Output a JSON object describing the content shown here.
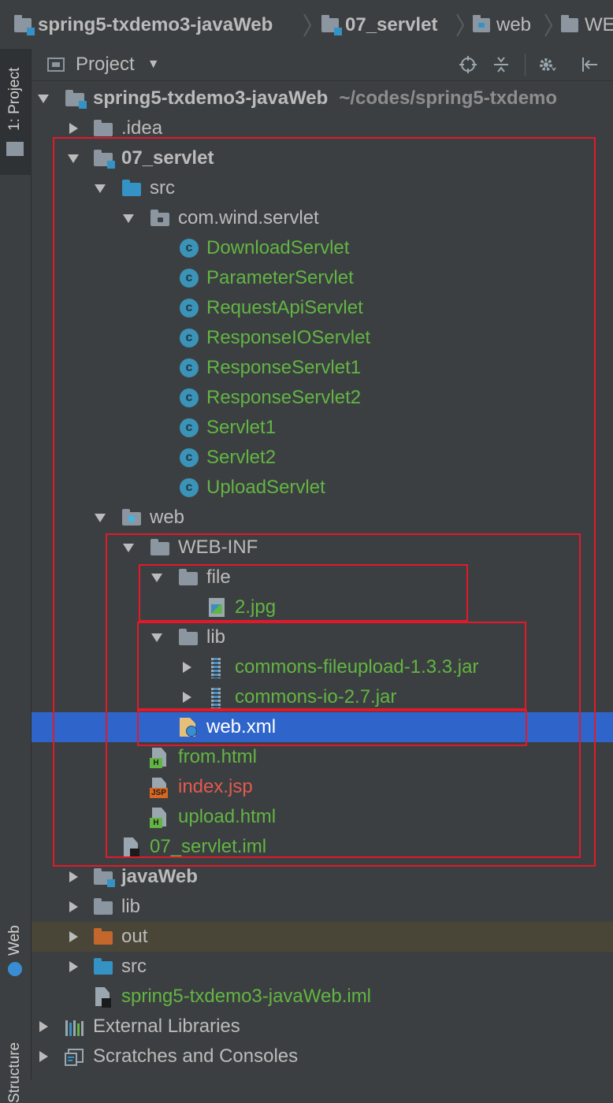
{
  "breadcrumb": {
    "items": [
      {
        "label": "spring5-txdemo3-javaWeb",
        "icon": "module-folder-icon"
      },
      {
        "label": "07_servlet",
        "icon": "module-folder-icon"
      },
      {
        "label": "web",
        "icon": "web-folder-icon"
      },
      {
        "label": "WE",
        "icon": "folder-icon"
      }
    ]
  },
  "left_strip": {
    "project_tab": "1: Project",
    "web_tab": "Web",
    "structure_tab": "Structure"
  },
  "project_panel": {
    "title": "Project",
    "toolbar_icons": [
      "locate-icon",
      "collapse-icon",
      "gear-icon",
      "hide-icon"
    ]
  },
  "tree": {
    "root": {
      "label": "spring5-txdemo3-javaWeb",
      "path": "~/codes/spring5-txdemo"
    },
    "idea": ".idea",
    "servlet_module": "07_servlet",
    "src": "src",
    "package": "com.wind.servlet",
    "classes": [
      "DownloadServlet",
      "ParameterServlet",
      "RequestApiServlet",
      "ResponseIOServlet",
      "ResponseServlet1",
      "ResponseServlet2",
      "Servlet1",
      "Servlet2",
      "UploadServlet"
    ],
    "web": "web",
    "web_inf": "WEB-INF",
    "file_dir": "file",
    "jpg": "2.jpg",
    "lib_dir": "lib",
    "jars": [
      "commons-fileupload-1.3.3.jar",
      "commons-io-2.7.jar"
    ],
    "web_xml": "web.xml",
    "from_html": "from.html",
    "index_jsp": "index.jsp",
    "upload_html": "upload.html",
    "servlet_iml": "07_servlet.iml",
    "javaweb": "javaWeb",
    "lib": "lib",
    "out": "out",
    "src2": "src",
    "root_iml": "spring5-txdemo3-javaWeb.iml",
    "external_libraries": "External Libraries",
    "scratches": "Scratches and Consoles"
  },
  "colors": {
    "background": "#3c3f41",
    "selection": "#2f65ca",
    "green_file": "#62b543",
    "red_file": "#e35a4f",
    "annotation_red": "#e3192a"
  }
}
